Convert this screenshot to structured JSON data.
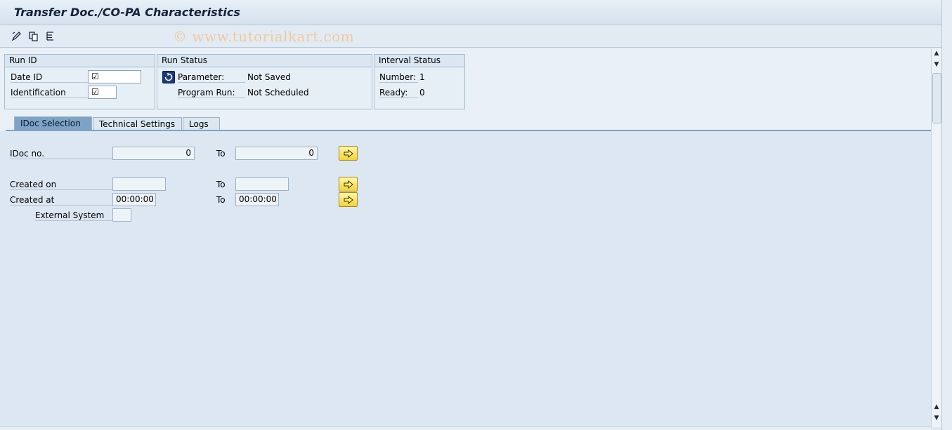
{
  "window": {
    "title": "Transfer Doc./CO-PA Characteristics",
    "watermark": "© www.tutorialkart.com"
  },
  "toolbar": {
    "icons": [
      "edit-pencil-icon",
      "copy-icon",
      "list-icon"
    ]
  },
  "run_id": {
    "header": "Run ID",
    "date_id_label": "Date ID",
    "identification_label": "Identification",
    "date_id_value": "☑",
    "identification_value": "☑"
  },
  "run_status": {
    "header": "Run Status",
    "parameter_label": "Parameter:",
    "parameter_value": "Not Saved",
    "program_run_label": "Program Run:",
    "program_run_value": "Not Scheduled"
  },
  "interval_status": {
    "header": "Interval Status",
    "number_label": "Number:",
    "number_value": "1",
    "ready_label": "Ready:",
    "ready_value": "0"
  },
  "tabs": [
    {
      "label": "IDoc Selection",
      "active": true
    },
    {
      "label": "Technical Settings",
      "active": false
    },
    {
      "label": "Logs",
      "active": false
    }
  ],
  "selection": {
    "idoc_no_label": "IDoc no.",
    "idoc_no_from": "0",
    "idoc_no_to": "0",
    "to_label": "To",
    "created_on_label": "Created on",
    "created_on_from": "",
    "created_on_to": "",
    "created_at_label": "Created at",
    "created_at_from": "00:00:00",
    "created_at_to": "00:00:00",
    "external_system_label": "External System",
    "external_system_value": ""
  },
  "colors": {
    "background": "#dce7f2",
    "active_tab": "#7ea3c7",
    "arrow_button": "#f2d23c"
  }
}
